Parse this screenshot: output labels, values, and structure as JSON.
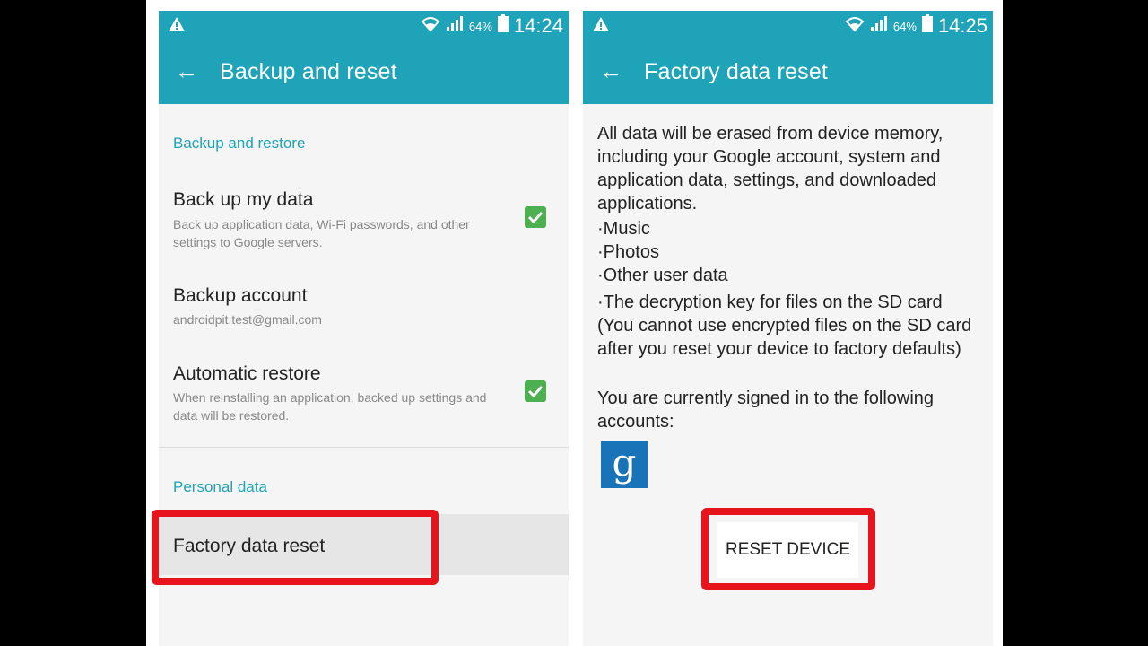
{
  "left": {
    "status": {
      "battery": "64%",
      "time": "14:24"
    },
    "appbar": {
      "title": "Backup and reset"
    },
    "section_backup": "Backup and restore",
    "backup_data": {
      "title": "Back up my data",
      "subtitle": "Back up application data, Wi-Fi passwords, and other settings to Google servers.",
      "checked": true
    },
    "backup_account": {
      "title": "Backup account",
      "subtitle": "androidpit.test@gmail.com"
    },
    "auto_restore": {
      "title": "Automatic restore",
      "subtitle": "When reinstalling an application, backed up settings and data will be restored.",
      "checked": true
    },
    "section_personal": "Personal data",
    "factory_reset": "Factory data reset"
  },
  "right": {
    "status": {
      "battery": "64%",
      "time": "14:25"
    },
    "appbar": {
      "title": "Factory data reset"
    },
    "intro": "All data will be erased from device memory, including your Google account, system and application data, settings, and downloaded applications.",
    "bullets": [
      "Music",
      "Photos",
      "Other user data",
      "The decryption key for files on the SD card (You cannot use encrypted files on the SD card after you reset your device to factory defaults)"
    ],
    "signed_in": "You are currently signed in to the following accounts:",
    "account_icon": "g",
    "reset_button": "RESET DEVICE"
  },
  "colors": {
    "accent": "#1fa3b8",
    "check": "#4caf50",
    "highlight": "#e8141c",
    "google": "#1873b8"
  }
}
